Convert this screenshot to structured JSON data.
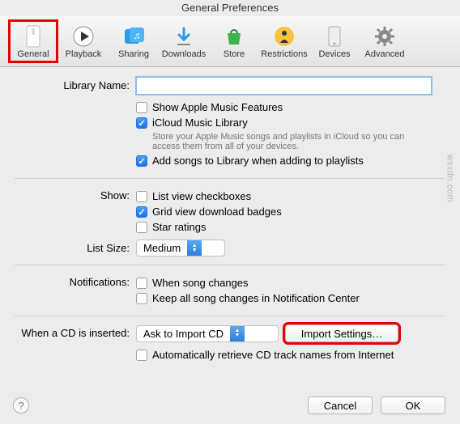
{
  "title": "General Preferences",
  "toolbar": [
    {
      "name": "general",
      "label": "General"
    },
    {
      "name": "playback",
      "label": "Playback"
    },
    {
      "name": "sharing",
      "label": "Sharing"
    },
    {
      "name": "downloads",
      "label": "Downloads"
    },
    {
      "name": "store",
      "label": "Store"
    },
    {
      "name": "restrictions",
      "label": "Restrictions"
    },
    {
      "name": "devices",
      "label": "Devices"
    },
    {
      "name": "advanced",
      "label": "Advanced"
    }
  ],
  "labels": {
    "library_name": "Library Name:",
    "show": "Show:",
    "list_size": "List Size:",
    "notifications": "Notifications:",
    "cd_inserted": "When a CD is inserted:"
  },
  "library_name_value": "",
  "checks": {
    "show_apple_music": "Show Apple Music Features",
    "icloud_library": "iCloud Music Library",
    "icloud_help": "Store your Apple Music songs and playlists in iCloud so you can access them from all of your devices.",
    "add_songs": "Add songs to Library when adding to playlists",
    "list_view": "List view checkboxes",
    "grid_view": "Grid view download badges",
    "star_ratings": "Star ratings",
    "when_song_changes": "When song changes",
    "keep_all_songs": "Keep all song changes in Notification Center",
    "auto_retrieve": "Automatically retrieve CD track names from Internet"
  },
  "list_size_value": "Medium",
  "cd_value": "Ask to Import CD",
  "buttons": {
    "import_settings": "Import Settings…",
    "cancel": "Cancel",
    "ok": "OK"
  },
  "watermark": "wsxdn.com",
  "highlight_red": "#e60000",
  "accent": "#2b7ee0"
}
